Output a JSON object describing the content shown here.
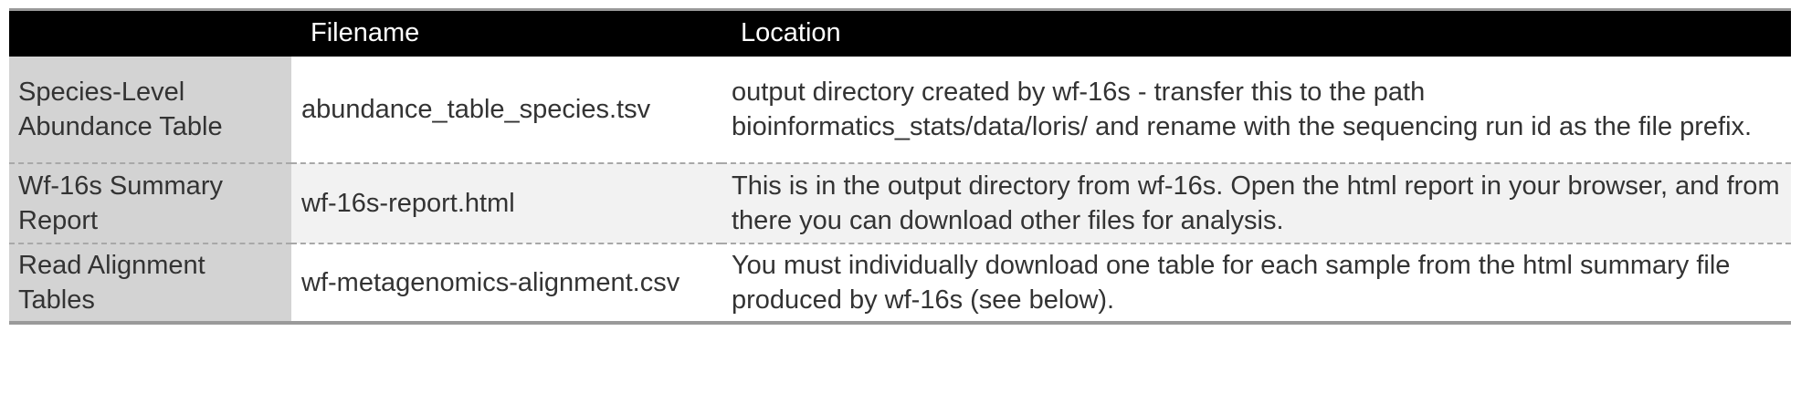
{
  "table": {
    "headers": [
      "",
      "Filename",
      "Location"
    ],
    "rows": [
      {
        "label": "Species-Level Abundance Table",
        "filename": "abundance_table_species.tsv",
        "location": "output directory created by wf-16s - transfer this to the path bioinformatics_stats/data/loris/ and rename with the sequencing run id as the file prefix."
      },
      {
        "label": "Wf-16s Summary Report",
        "filename": "wf-16s-report.html",
        "location": "This is in the output directory from wf-16s. Open the html report in your browser, and from there you can download other files for analysis."
      },
      {
        "label": "Read Alignment Tables",
        "filename": "wf-metagenomics-alignment.csv",
        "location": "You must individually download one table for each sample from the html summary file produced by wf-16s (see below)."
      }
    ]
  },
  "colors": {
    "header_background": "#000000",
    "header_text": "#ffffff",
    "label_column_background": "#d3d3d3",
    "alternate_row_background": "#f2f2f2",
    "text": "#333333"
  }
}
